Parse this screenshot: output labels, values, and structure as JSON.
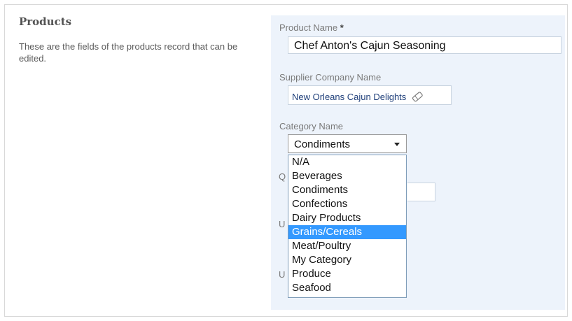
{
  "section": {
    "title": "Products",
    "description": "These are the fields of the products record that can be edited."
  },
  "fields": {
    "product_name_label": "Product Name",
    "required_marker": "*",
    "product_name_value": "Chef Anton's Cajun Seasoning",
    "supplier_label": "Supplier Company Name",
    "supplier_value": "New Orleans Cajun Delights",
    "category_label": "Category Name",
    "category_value": "Condiments",
    "partial_label_q": "Q",
    "partial_label_u1": "U",
    "partial_label_u2": "U"
  },
  "category_options": [
    "N/A",
    "Beverages",
    "Condiments",
    "Confections",
    "Dairy Products",
    "Grains/Cereals",
    "Meat/Poultry",
    "My Category",
    "Produce",
    "Seafood"
  ],
  "highlighted_option": "Grains/Cereals",
  "icons": {
    "clear": "eraser-icon",
    "dropdown": "chevron-down-icon"
  },
  "colors": {
    "panel": "#edf3fb",
    "highlight": "#3399ff",
    "link": "#1f3f7a"
  }
}
